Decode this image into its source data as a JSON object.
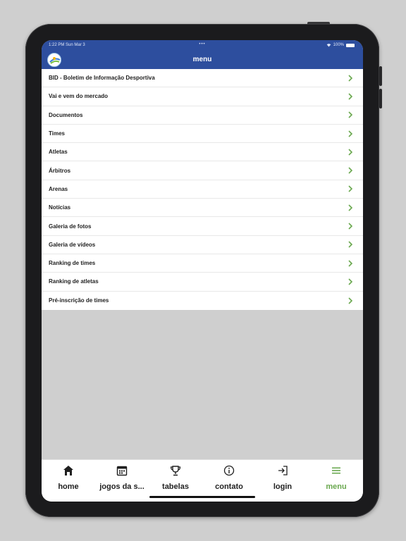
{
  "status": {
    "time": "1:22 PM  Sun Mar 3",
    "dots": "•••",
    "battery": "100%"
  },
  "header": {
    "title": "menu"
  },
  "menu": {
    "items": [
      {
        "label": "BID - Boletim de Informação Desportiva"
      },
      {
        "label": "Vai e vem do mercado"
      },
      {
        "label": "Documentos"
      },
      {
        "label": "Times"
      },
      {
        "label": "Atletas"
      },
      {
        "label": "Árbitros"
      },
      {
        "label": "Arenas"
      },
      {
        "label": "Notícias"
      },
      {
        "label": "Galeria de fotos"
      },
      {
        "label": "Galeria de vídeos"
      },
      {
        "label": "Ranking de times"
      },
      {
        "label": "Ranking de atletas"
      },
      {
        "label": "Pré-inscrição de times"
      }
    ]
  },
  "tabs": [
    {
      "label": "home",
      "icon": "home-icon"
    },
    {
      "label": "jogos da s...",
      "icon": "calendar-icon"
    },
    {
      "label": "tabelas",
      "icon": "trophy-icon"
    },
    {
      "label": "contato",
      "icon": "info-icon"
    },
    {
      "label": "login",
      "icon": "login-icon"
    },
    {
      "label": "menu",
      "icon": "menu-icon",
      "active": true
    }
  ],
  "colors": {
    "header": "#2d4e9e",
    "accent": "#6aa84f",
    "chevron": "#6aa84f"
  }
}
